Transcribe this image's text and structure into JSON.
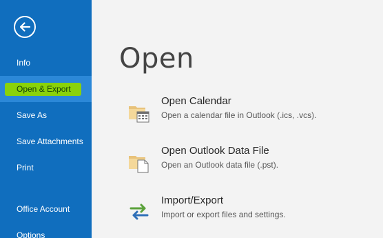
{
  "sidebar": {
    "back_icon": "back-arrow-icon",
    "items": [
      {
        "label": "Info"
      },
      {
        "label": "Open & Export",
        "selected": true
      },
      {
        "label": "Save As"
      },
      {
        "label": "Save Attachments"
      },
      {
        "label": "Print"
      },
      {
        "label": "Office Account"
      },
      {
        "label": "Options"
      }
    ],
    "colors": {
      "background": "#106ebe",
      "selected": "#2b88d8",
      "highlight": "#8fd600"
    }
  },
  "main": {
    "title": "Open",
    "options": [
      {
        "title": "Open Calendar",
        "description": "Open a calendar file in Outlook (.ics, .vcs).",
        "icon": "folder-calendar-icon"
      },
      {
        "title": "Open Outlook Data File",
        "description": "Open an Outlook data file (.pst).",
        "icon": "folder-document-icon"
      },
      {
        "title": "Import/Export",
        "description": "Import or export files and settings.",
        "icon": "import-export-arrows-icon"
      }
    ]
  }
}
